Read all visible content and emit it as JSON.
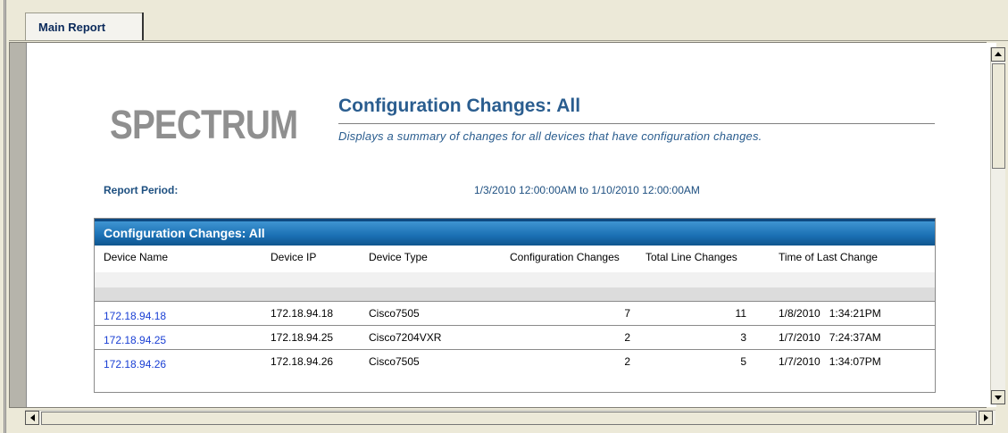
{
  "tabs": [
    {
      "label": "Main Report",
      "active": true
    }
  ],
  "report": {
    "logo_text": "SPECTRUM",
    "title": "Configuration Changes: All",
    "subtitle": "Displays a summary of changes for all devices that have configuration changes.",
    "period_label": "Report Period:",
    "period_value": "1/3/2010  12:00:00AM to 1/10/2010  12:00:00AM",
    "table": {
      "heading": "Configuration Changes: All",
      "columns": [
        "Device Name",
        "Device IP",
        "Device Type",
        "Configuration Changes",
        "Total Line Changes",
        "Time of Last Change"
      ],
      "rows": [
        {
          "name": "172.18.94.18",
          "ip": "172.18.94.18",
          "type": "Cisco7505",
          "config_changes": "7",
          "line_changes": "11",
          "last_change": "1/8/2010   1:34:21PM"
        },
        {
          "name": "172.18.94.25",
          "ip": "172.18.94.25",
          "type": "Cisco7204VXR",
          "config_changes": "2",
          "line_changes": "3",
          "last_change": "1/7/2010   7:24:37AM"
        },
        {
          "name": "172.18.94.26",
          "ip": "172.18.94.26",
          "type": "Cisco7505",
          "config_changes": "2",
          "line_changes": "5",
          "last_change": "1/7/2010   1:34:07PM"
        }
      ]
    }
  },
  "colors": {
    "accent": "#2a5d8f",
    "header_bar": "#1a6fb3",
    "link": "#1a3fd4",
    "logo": "#8f8f8f"
  },
  "icons": {
    "scroll_up": "triangle-up-icon",
    "scroll_down": "triangle-down-icon",
    "scroll_left": "triangle-left-icon",
    "scroll_right": "triangle-right-icon"
  }
}
